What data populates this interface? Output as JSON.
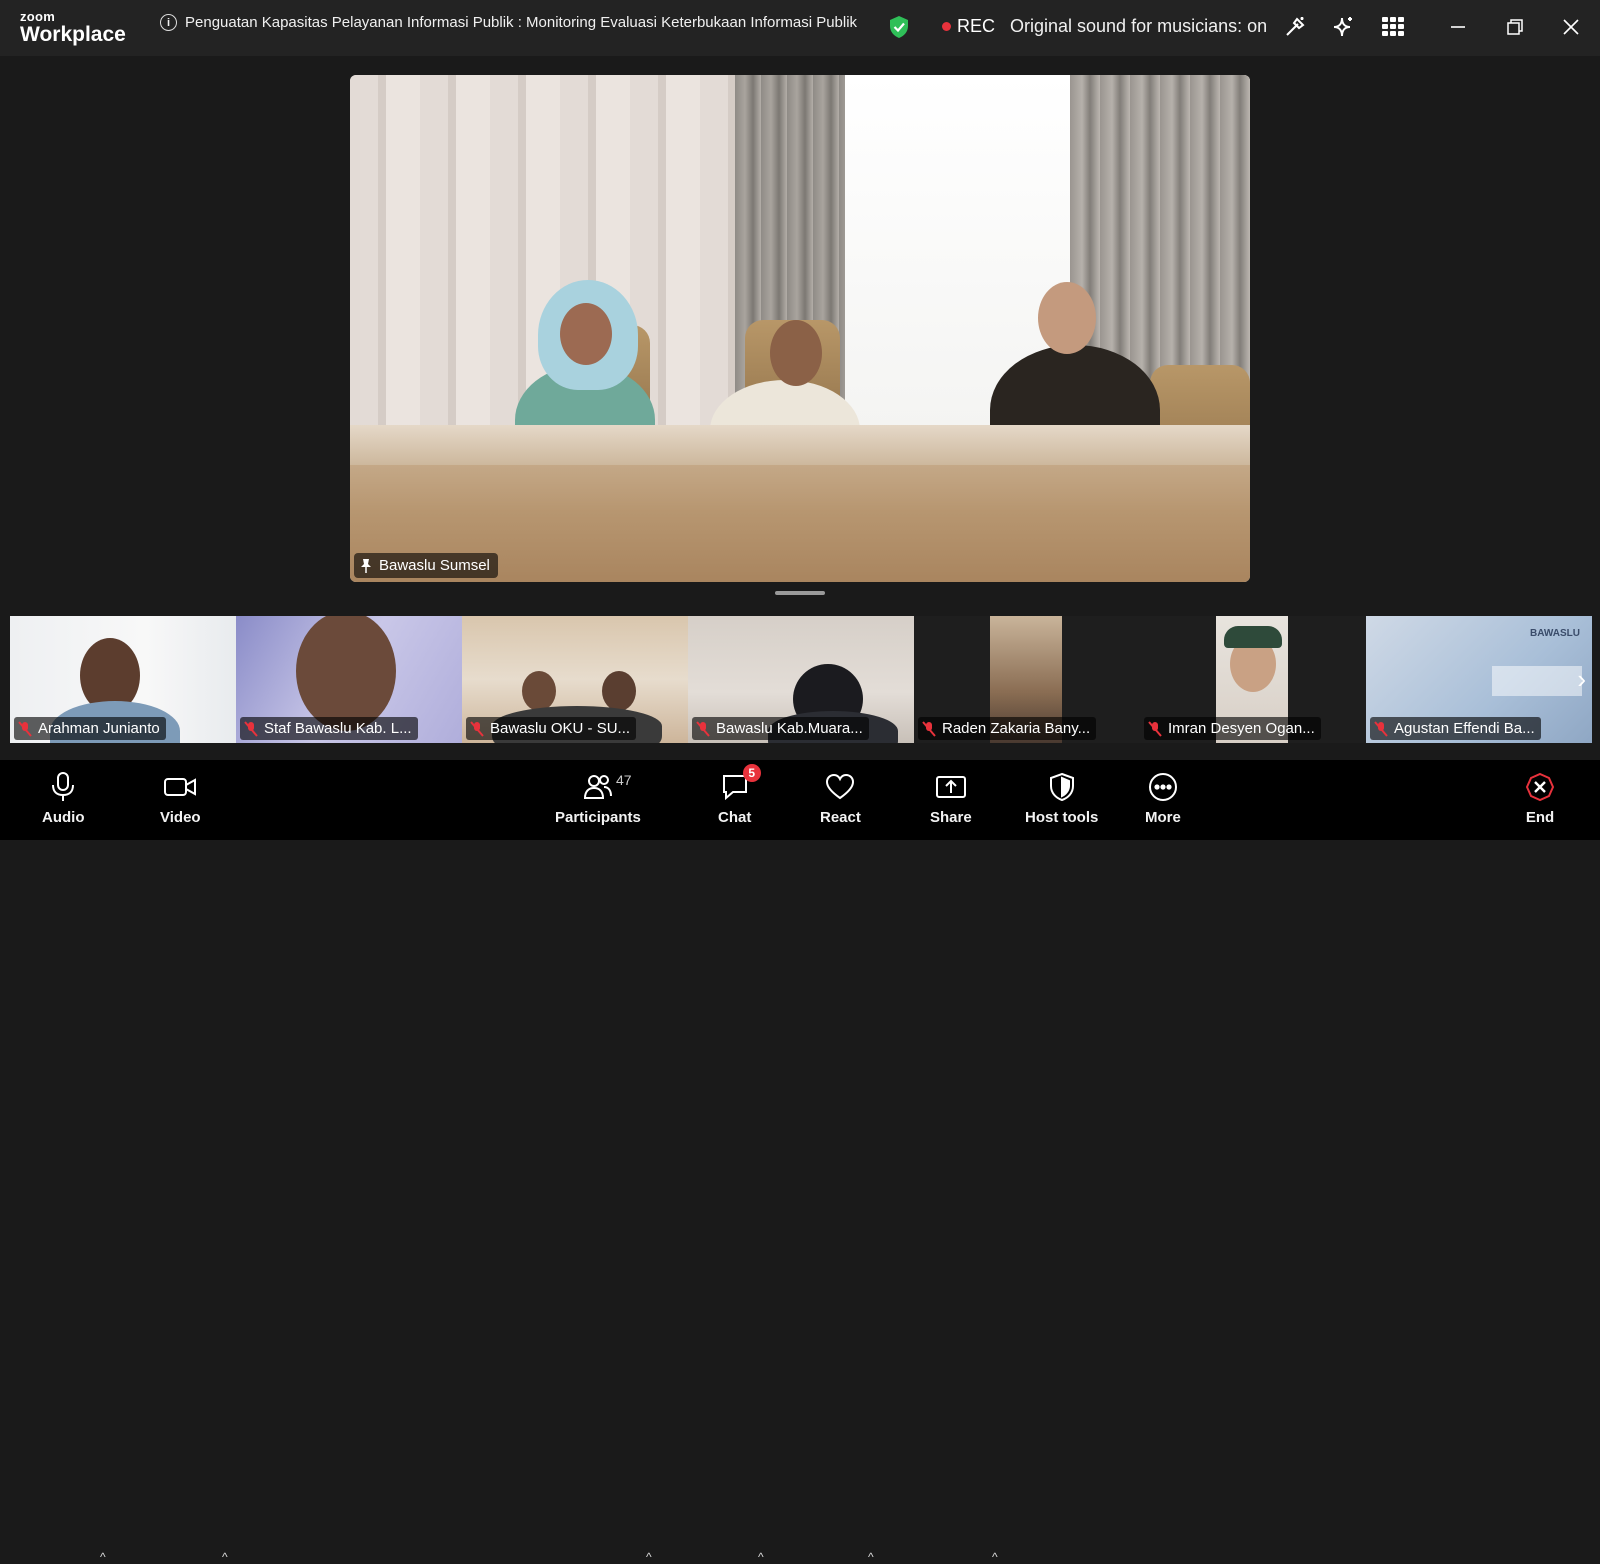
{
  "app": {
    "logo_small": "zoom",
    "logo_big": "Workplace"
  },
  "meeting": {
    "title": "Penguatan Kapasitas Pelayanan Informasi Publik : Monitoring Evaluasi Keterbukaan Informasi Publik",
    "rec_label": "REC",
    "original_sound": "Original sound for musicians: on"
  },
  "main_video": {
    "name": "Bawaslu Sumsel",
    "pinned": true
  },
  "participants_strip": [
    {
      "name": "Arahman Junianto",
      "muted": true
    },
    {
      "name": "Staf Bawaslu Kab. L...",
      "muted": true
    },
    {
      "name": "Bawaslu OKU - SU...",
      "muted": true
    },
    {
      "name": "Bawaslu Kab.Muara...",
      "muted": true
    },
    {
      "name": "Raden Zakaria Bany...",
      "muted": true
    },
    {
      "name": "Imran Desyen Ogan...",
      "muted": true
    },
    {
      "name": "Agustan Effendi Ba...",
      "muted": true
    }
  ],
  "thumb7_logo": "BAWASLU",
  "toolbar": {
    "audio": "Audio",
    "video": "Video",
    "participants": "Participants",
    "participants_count": "47",
    "chat": "Chat",
    "chat_badge": "5",
    "react": "React",
    "share": "Share",
    "host_tools": "Host tools",
    "more": "More",
    "end": "End"
  },
  "colors": {
    "accent_green": "#2fbf58",
    "rec_red": "#e8323c",
    "end_red": "#e8323c"
  }
}
